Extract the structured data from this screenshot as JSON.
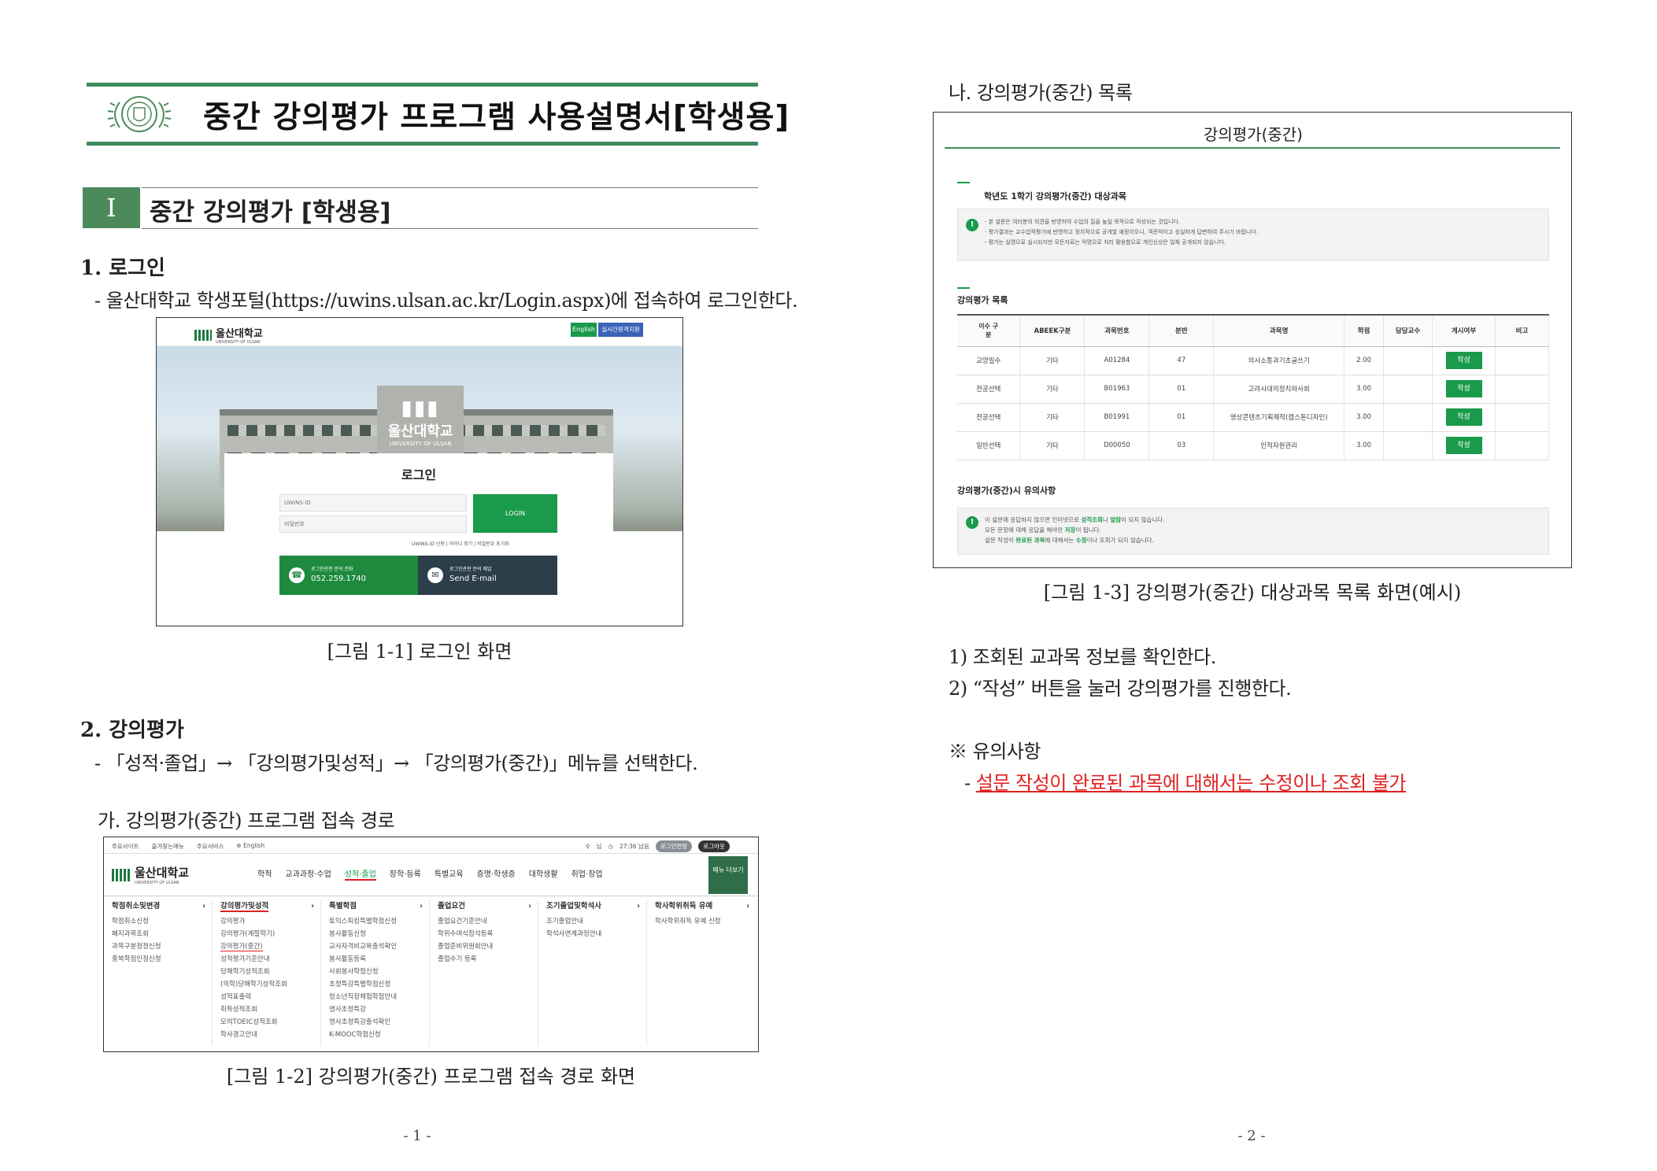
{
  "page1": {
    "doc_title": "중간 강의평가 프로그램 사용설명서[학생용]",
    "section_num": "Ⅰ",
    "section_title": "중간 강의평가 [학생용]",
    "s1_heading": "1. 로그인",
    "s1_text": "- 울산대학교 학생포털(https://uwins.ulsan.ac.kr/Login.aspx)에 접속하여 로그인한다.",
    "login": {
      "logo": "울산대학교",
      "logo_sub": "UNIVERSITY OF ULSAN",
      "btn_english": "English",
      "btn_realtime": "실시간원격지원",
      "building_sign": "울산대학교",
      "building_sign_sub": "UNIVERSITY OF ULSAN",
      "title": "로그인",
      "id_placeholder": "UWINS-ID",
      "pw_placeholder": "비밀번호",
      "login_btn": "LOGIN",
      "links": "UWINS-ID 신청  |  아이디 찾기  |  비밀번호 초기화",
      "phone_label": "로그인관련 문의 전화",
      "phone_num": "052.259.1740",
      "email_label": "로그인관련 문의 메일",
      "email_val": "Send E-mail"
    },
    "cap1": "[그림 1-1] 로그인 화면",
    "s2_heading": "2. 강의평가",
    "s2_text": "- 「성적·졸업」→ 「강의평가및성적」→ 「강의평가(중간)」메뉴를 선택한다.",
    "s2_sub": "가. 강의평가(중간) 프로그램 접속 경로",
    "menu": {
      "toplinks": [
        "주요사이트",
        "즐겨찾는메뉴",
        "주요서비스",
        "English"
      ],
      "timer": "27:36 남음",
      "btn_extend": "로그인연장",
      "btn_logout": "로그아웃",
      "nav": [
        "학적",
        "교과과정·수업",
        "성적·졸업",
        "장학·등록",
        "특별교육",
        "증명·학생증",
        "대학생활",
        "취업·창업"
      ],
      "menu_more": "메뉴 더보기",
      "columns": [
        {
          "head": "학점취소및변경",
          "items": [
            "학점취소신청",
            "폐지과목조회",
            "과목구분정정신청",
            "중복학점인정신청"
          ]
        },
        {
          "head": "강의평가및성적",
          "items": [
            "강의평가",
            "강의평가(계절학기)",
            "강의평가(중간)",
            "성적평가기준안내",
            "당해학기성적조회",
            "(의학)당해학기성적조회",
            "성적표출력",
            "취득성적조회",
            "모의TOEIC성적조회",
            "학사경고안내"
          ]
        },
        {
          "head": "특별학점",
          "items": [
            "토익스피킹특별학점신청",
            "봉사활동신청",
            "교사자격비교육출석확인",
            "봉사활동등록",
            "사회봉사학점신청",
            "초청특강특별학점신청",
            "청소년직장체험학점안내",
            "명사초청특강",
            "명사초청특강출석확인",
            "K-MOOC학점신청"
          ]
        },
        {
          "head": "졸업요건",
          "items": [
            "졸업요건기준안내",
            "학위수여식참석등록",
            "졸업준비위원회안내",
            "졸업수기 등록"
          ]
        },
        {
          "head": "조기졸업및학석사",
          "items": [
            "조기졸업안내",
            "학석사연계과정안내"
          ]
        },
        {
          "head": "학사학위취득 유예",
          "items": [
            "학사학위취득 유예 신청"
          ]
        }
      ]
    },
    "cap2": "[그림 1-2] 강의평가(중간) 프로그램 접속 경로 화면",
    "page_no": "- 1 -"
  },
  "page2": {
    "sub_heading": "나. 강의평가(중간) 목록",
    "screen": {
      "title": "강의평가(중간)",
      "target_heading": "학년도 1학기 강의평가(중간) 대상과목",
      "notice_lines": [
        "- 본 설문은 여러분의 의견을 반영하여 수업의 질을 높일 목적으로 작성되는 것입니다.",
        "- 평가결과는 교수업적평가에 반영하고 정치적으로 공개할 예정이오니, 객관적이고 성실하게 답변하여 주시기 바랍니다.",
        "- 평가는 실명으로 실시되지만 모든자료는 익명으로 처리 활용함으로 개인신상은 일체 공개되지 않습니다."
      ],
      "list_heading": "강의평가 목록",
      "columns": [
        "이수 구분",
        "ABEEK구분",
        "과목번호",
        "분반",
        "과목명",
        "학점",
        "담당교수",
        "게시여부",
        "비고"
      ],
      "rows": [
        [
          "교양필수",
          "기타",
          "A01284",
          "47",
          "의사소통과기초글쓰기",
          "2.00",
          "",
          "작성",
          ""
        ],
        [
          "전공선택",
          "기타",
          "B01963",
          "01",
          "고려시대의정치와사회",
          "3.00",
          "",
          "작성",
          ""
        ],
        [
          "전공선택",
          "기타",
          "B01991",
          "01",
          "영상콘텐츠기획제작(캡스톤디자인)",
          "3.00",
          "",
          "작성",
          ""
        ],
        [
          "일반선택",
          "기타",
          "D00050",
          "03",
          "인적자원관리",
          "3.00",
          "",
          "작성",
          ""
        ]
      ],
      "caution_heading": "강의평가(중간)시 유의사항",
      "caution_lines": [
        {
          "a": "이 설문에 응답하지 않으면 인터넷으로 ",
          "b": "성적조회",
          "c": "나 ",
          "d": "열람",
          "e": "이 되지 않습니다."
        },
        {
          "a": "모든 문항에 대해 응답을 해야만 ",
          "b": "저장",
          "c": "이 됩니다.",
          "d": "",
          "e": ""
        },
        {
          "a": "설문 작성이 ",
          "b": "완료된 과목",
          "c": "에 대해서는 ",
          "d": "수정",
          "e": "이나 조회가 되지 않습니다."
        }
      ]
    },
    "cap3": "[그림 1-3] 강의평가(중간) 대상과목 목록 화면(예시)",
    "steps": [
      "1)  조회된 교과목 정보를 확인한다.",
      "2)  “작성” 버튼을 눌러 강의평가를 진행한다."
    ],
    "notes_heading": "※ 유의사항",
    "notes_dash": "-",
    "notes_red": "설문 작성이 완료된 과목에 대해서는 수정이나 조회 불가",
    "page_no": "- 2 -"
  },
  "colors": {
    "accent_green": "#3f8a5c",
    "button_green": "#1a9a4b",
    "warning_red": "#e02020"
  }
}
